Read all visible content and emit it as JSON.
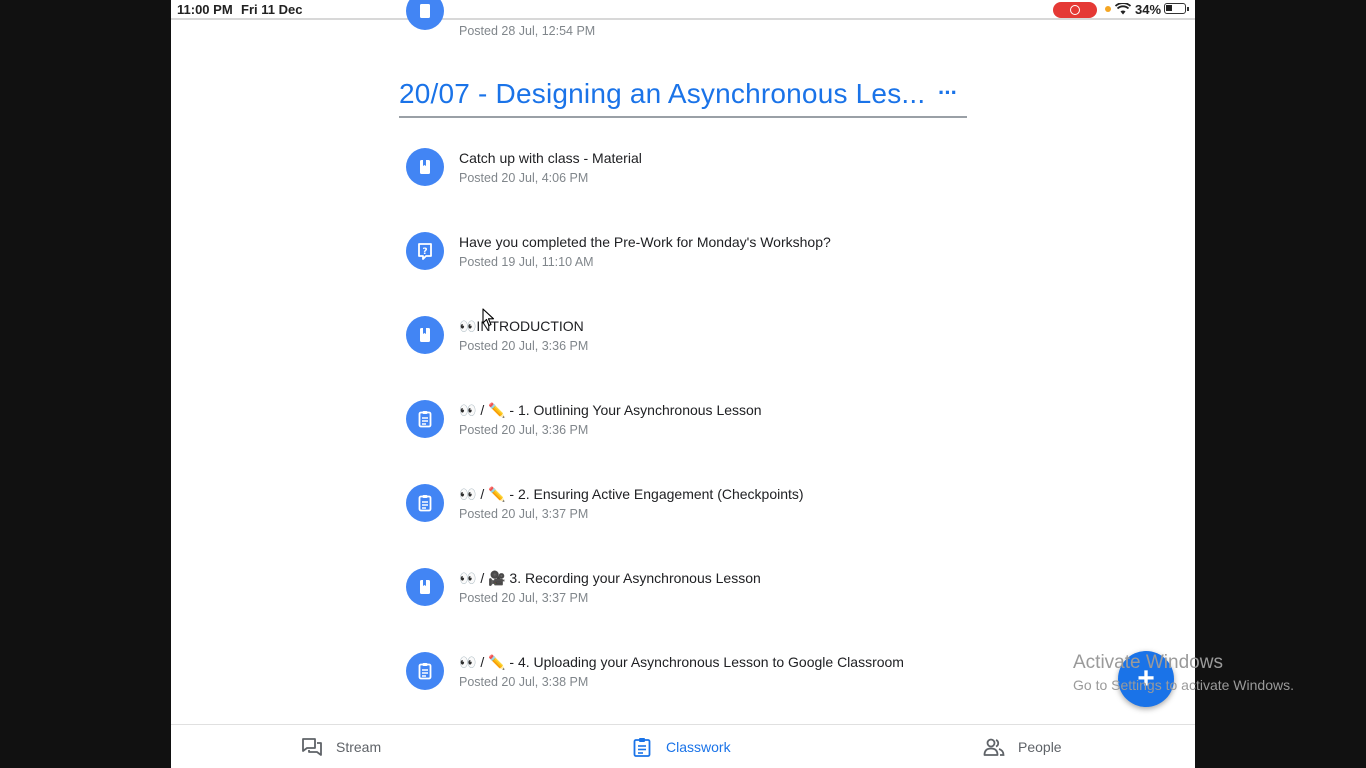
{
  "status_bar": {
    "time": "11:00 PM",
    "date": "Fri 11 Dec",
    "battery": "34%"
  },
  "previous_item": {
    "date": "Posted 28 Jul, 12:54 PM"
  },
  "topic": {
    "title": "20/07 - Designing an Asynchronous Les...",
    "menu_label": "···"
  },
  "items": [
    {
      "title": "Catch up with class - Material",
      "date": "Posted 20 Jul, 4:06 PM",
      "icon": "material-icon"
    },
    {
      "title": "Have you completed the Pre-Work for Monday's Workshop?",
      "date": "Posted 19 Jul, 11:10 AM",
      "icon": "question-icon"
    },
    {
      "title": "👀INTRODUCTION",
      "date": "Posted 20 Jul, 3:36 PM",
      "icon": "material-icon"
    },
    {
      "title": "👀 / ✏️ - 1. Outlining Your Asynchronous Lesson",
      "date": "Posted 20 Jul, 3:36 PM",
      "icon": "assignment-icon"
    },
    {
      "title": "👀 / ✏️ - 2. Ensuring Active Engagement (Checkpoints)",
      "date": "Posted 20 Jul, 3:37 PM",
      "icon": "assignment-icon"
    },
    {
      "title": "👀 / 🎥 3. Recording your Asynchronous Lesson",
      "date": "Posted 20 Jul, 3:37 PM",
      "icon": "material-icon"
    },
    {
      "title": "👀 / ✏️ - 4. Uploading your Asynchronous Lesson to Google Classroom",
      "date": "Posted 20 Jul, 3:38 PM",
      "icon": "assignment-icon"
    }
  ],
  "fab": {
    "label": "+"
  },
  "watermark": {
    "line1": "Activate Windows",
    "line2": "Go to Settings to activate Windows."
  },
  "bottom_nav": {
    "stream": "Stream",
    "classwork": "Classwork",
    "people": "People",
    "active": "classwork"
  },
  "colors": {
    "accent": "#1a73e8",
    "icon_bg": "#4285f4",
    "record": "#e53935"
  }
}
